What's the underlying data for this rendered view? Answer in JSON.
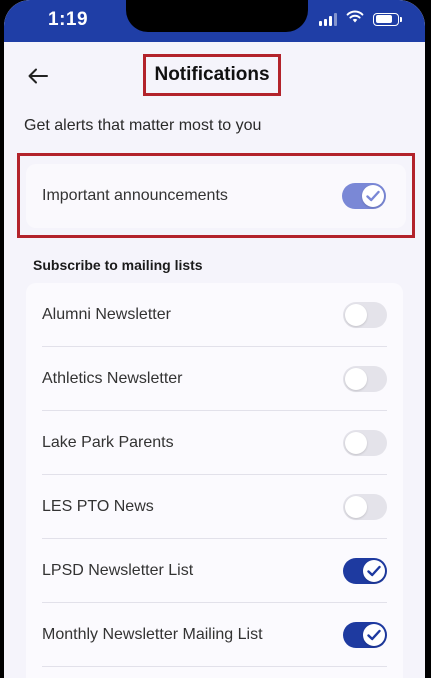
{
  "status_bar": {
    "time": "1:19"
  },
  "header": {
    "title": "Notifications"
  },
  "subtitle": "Get alerts that matter most to you",
  "important": {
    "label": "Important announcements",
    "enabled": true
  },
  "mailing": {
    "heading": "Subscribe to mailing lists",
    "items": [
      {
        "label": "Alumni Newsletter",
        "enabled": false
      },
      {
        "label": "Athletics Newsletter",
        "enabled": false
      },
      {
        "label": "Lake Park Parents",
        "enabled": false
      },
      {
        "label": "LES PTO News",
        "enabled": false
      },
      {
        "label": "LPSD Newsletter List",
        "enabled": true
      },
      {
        "label": "Monthly Newsletter Mailing List",
        "enabled": true
      }
    ]
  },
  "colors": {
    "accent": "#1e3aa0",
    "highlight_border": "#b3232b",
    "status_bar": "#1f3ea6"
  },
  "icons": {
    "back": "arrow-left-icon",
    "check": "check-icon",
    "wifi": "wifi-icon",
    "signal": "cellular-signal-icon",
    "battery": "battery-icon"
  }
}
